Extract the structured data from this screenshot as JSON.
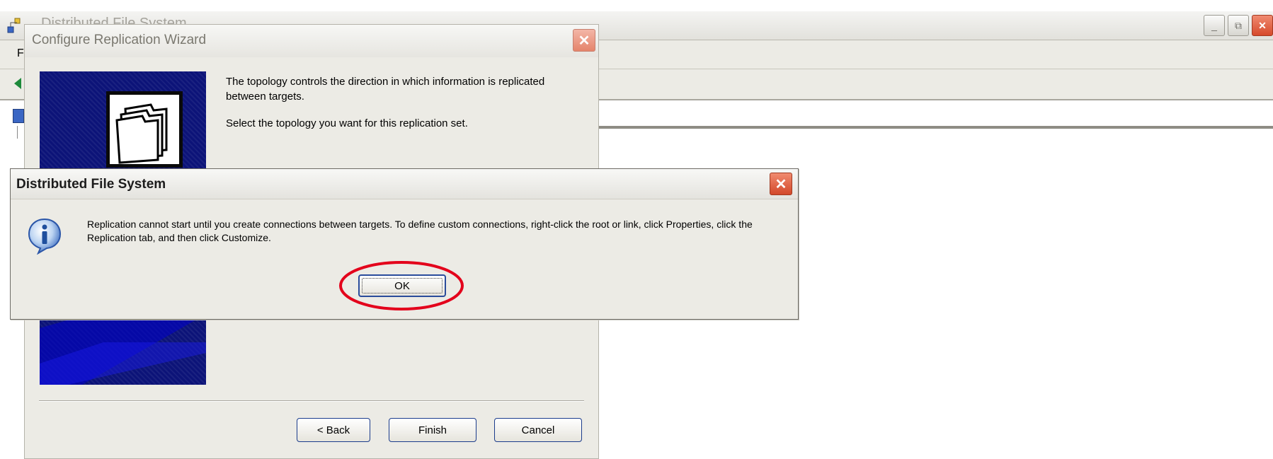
{
  "main_window": {
    "title": "Distributed File System",
    "menu_first_letter": "F",
    "buttons": {
      "minimize": "_",
      "restore": "⧉",
      "close": "✕"
    }
  },
  "wizard": {
    "title": "Configure Replication Wizard",
    "description": "The topology controls the direction in which information is replicated between targets.",
    "instruction": "Select the topology you want for this replication set.",
    "buttons": {
      "back": "< Back",
      "finish": "Finish",
      "cancel": "Cancel",
      "close": "✕"
    }
  },
  "message_box": {
    "title": "Distributed File System",
    "message": "Replication cannot start until you create connections between targets. To define custom connections, right-click the root or link, click Properties, click the Replication tab, and then click Customize.",
    "ok_label": "OK",
    "close": "✕",
    "icon": "information-icon"
  },
  "colors": {
    "wizard_banner": "#0c1378",
    "xp_border": "#1b3c8c",
    "close_red": "#d3482a",
    "highlight_ring": "#e3001b"
  }
}
